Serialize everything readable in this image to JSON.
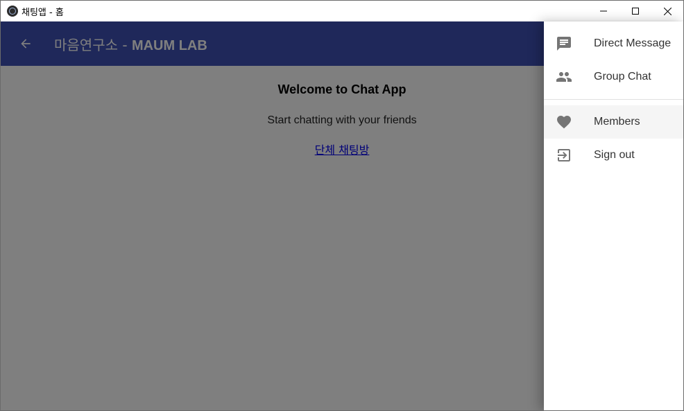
{
  "window": {
    "title": "채팅앱 - 홈"
  },
  "appbar": {
    "title_prefix": "마음연구소 - ",
    "title_bold": "MAUM LAB"
  },
  "main": {
    "welcome": "Welcome to Chat App",
    "subtitle": "Start chatting with your friends",
    "group_link": "단체 채팅방"
  },
  "drawer": {
    "items": [
      {
        "label": "Direct Message",
        "icon": "chat-message-icon"
      },
      {
        "label": "Group Chat",
        "icon": "people-icon"
      },
      {
        "label": "Members",
        "icon": "heart-icon"
      },
      {
        "label": "Sign out",
        "icon": "sign-out-icon"
      }
    ]
  },
  "colors": {
    "appbar": "#3f51b5",
    "backdrop": "rgba(0,0,0,0.5)",
    "drawer_icon": "#757575"
  }
}
